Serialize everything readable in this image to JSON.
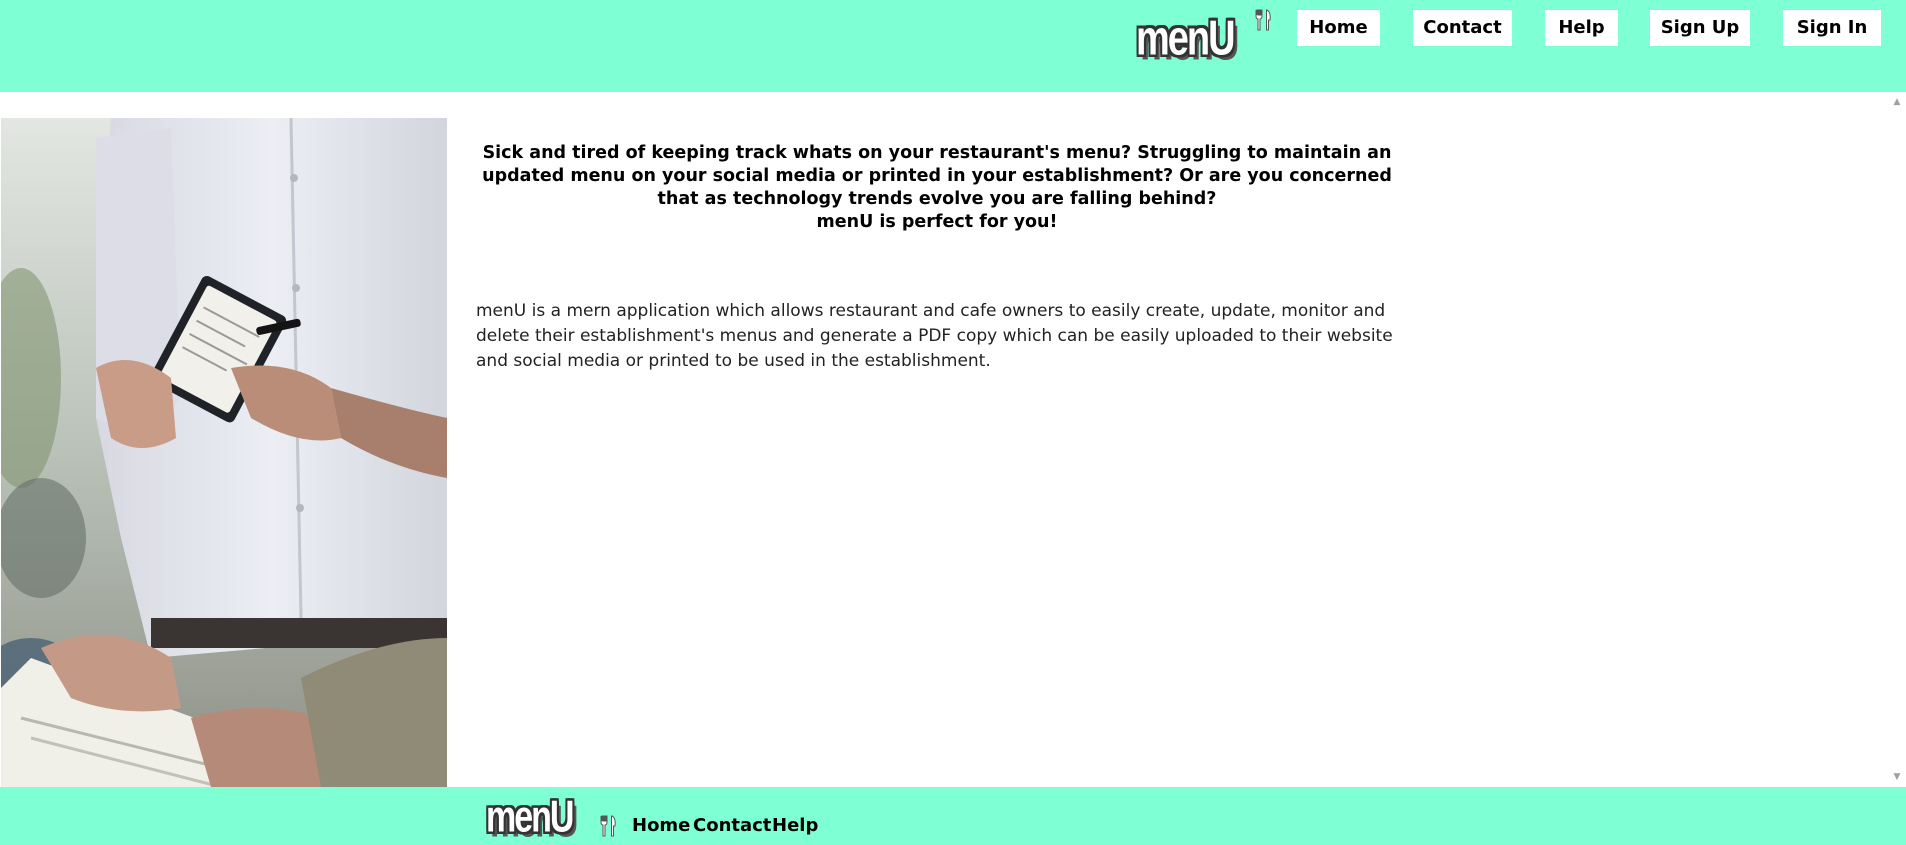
{
  "header": {
    "logo_text": "menU",
    "nav": {
      "home": "Home",
      "contact": "Contact",
      "help": "Help",
      "sign_up": "Sign Up",
      "sign_in": "Sign In"
    }
  },
  "main": {
    "tagline": {
      "line1": "Sick and tired of keeping track whats on your restaurant's menu? Struggling to maintain an updated menu on your social media or printed in your establishment? Or are you concerned that as technology trends evolve you are falling behind?",
      "line2": "menU is perfect for you!"
    },
    "description": "menU is a mern application which allows restaurant and cafe owners to easily create, update, monitor and delete their establishment's menus and generate a PDF copy which can be easily uploaded to their website and social media or printed to be used in the establishment."
  },
  "footer": {
    "logo_text": "menU",
    "links": {
      "home": "Home",
      "contact": "Contact",
      "help": "Help"
    }
  },
  "colors": {
    "brand_mint": "#7fffd4",
    "button_bg": "#ffffff",
    "text": "#000000"
  },
  "icons": {
    "brand_icon": "fork-knife-icon",
    "scroll_up": "scroll-up-arrow-icon",
    "scroll_down": "scroll-down-arrow-icon"
  }
}
